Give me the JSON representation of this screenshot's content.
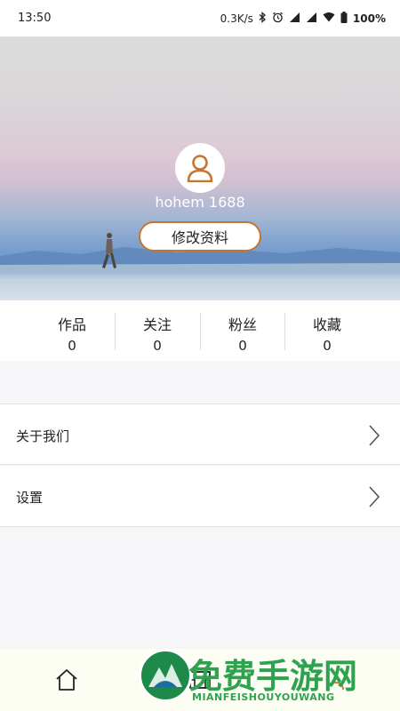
{
  "status_bar": {
    "time": "13:50",
    "network_speed": "0.3K/s",
    "battery": "100%"
  },
  "profile": {
    "username": "hohem 1688",
    "edit_label": "修改资料"
  },
  "stats": [
    {
      "label": "作品",
      "count": "0"
    },
    {
      "label": "关注",
      "count": "0"
    },
    {
      "label": "粉丝",
      "count": "0"
    },
    {
      "label": "收藏",
      "count": "0"
    }
  ],
  "menu": [
    {
      "label": "关于我们"
    },
    {
      "label": "设置"
    }
  ],
  "bottom_nav": [
    {
      "icon": "home-icon"
    },
    {
      "icon": "video-icon"
    },
    {
      "icon": "profile-icon"
    }
  ],
  "watermark": {
    "title": "免费手游网",
    "subtitle": "MIANFEISHOUYOUWANG"
  },
  "colors": {
    "accent": "#c8742e",
    "watermark": "#2fa24f"
  }
}
